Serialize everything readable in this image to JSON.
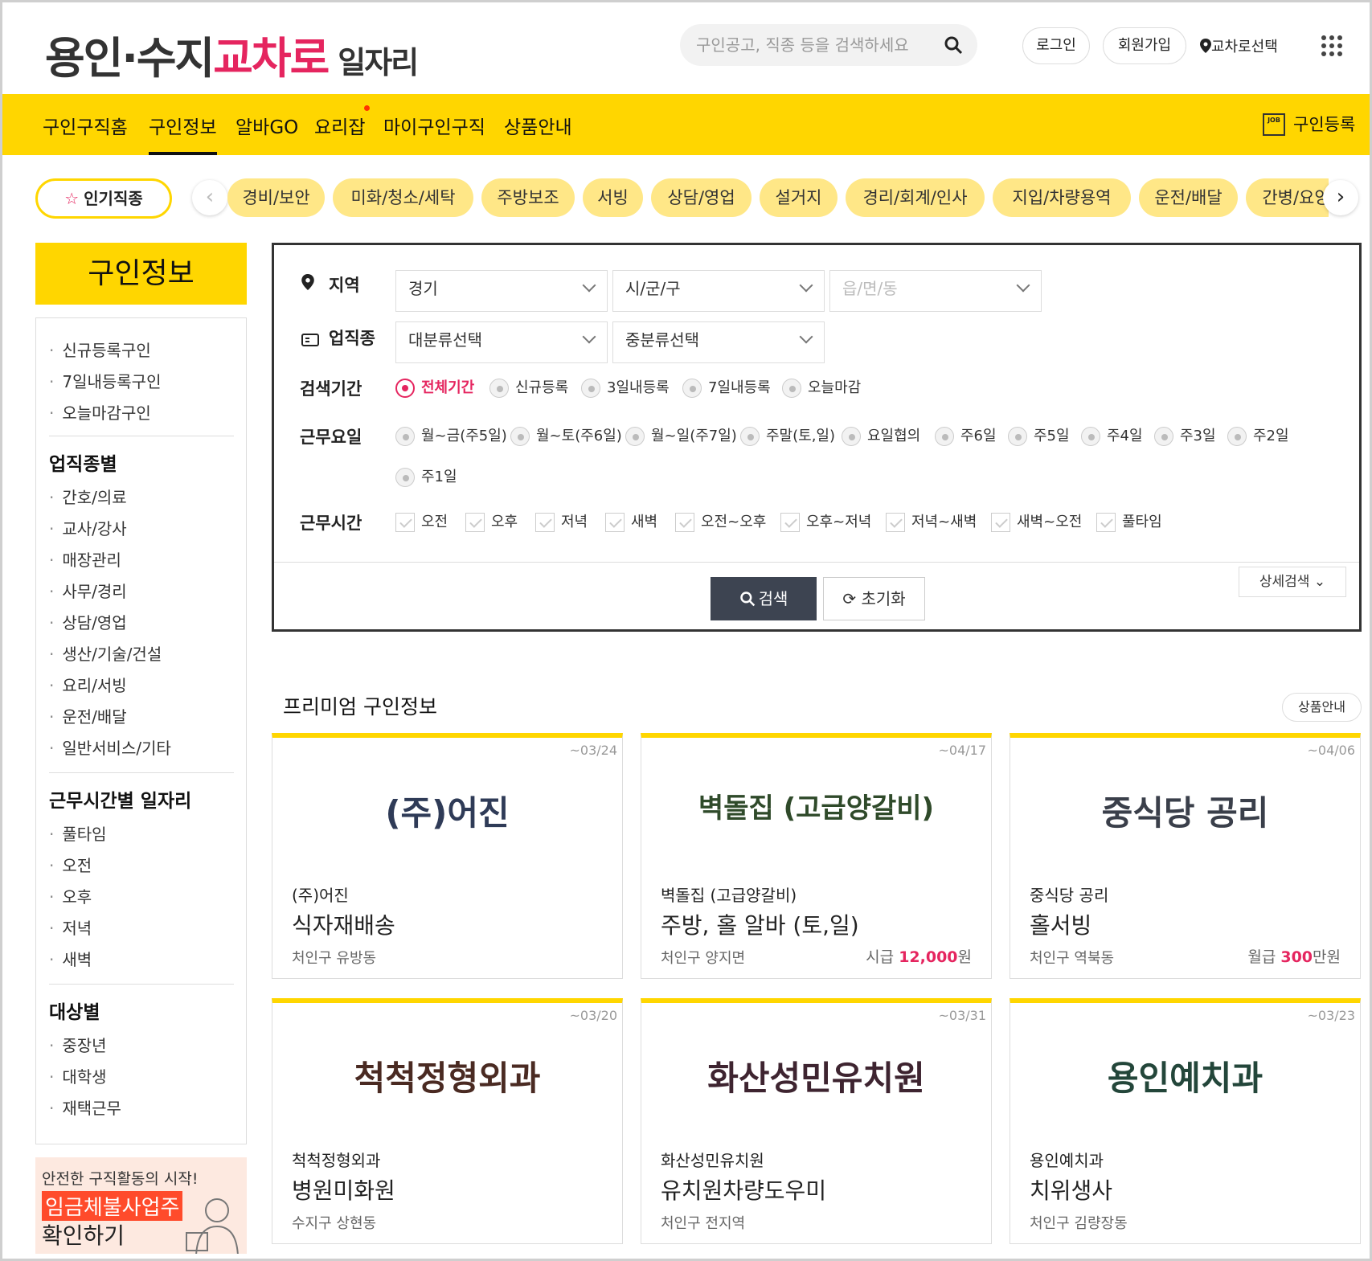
{
  "header": {
    "logo_main": "용인·수지",
    "logo_brand": "교차로",
    "logo_sub": "일자리",
    "search_placeholder": "구인공고, 직종 등을 검색하세요",
    "login": "로그인",
    "signup": "회원가입",
    "area_select": "교차로선택"
  },
  "nav": {
    "items": [
      "구인구직홈",
      "구인정보",
      "알바GO",
      "요리잡",
      "마이구인구직",
      "상품안내"
    ],
    "active": "구인정보",
    "register": "구인등록",
    "job_icon_text": "JOB"
  },
  "chips": {
    "popular": "인기직종",
    "items": [
      "경비/보안",
      "미화/청소/세탁",
      "주방보조",
      "서빙",
      "상담/영업",
      "설거지",
      "경리/회계/인사",
      "지입/차량용역",
      "운전/배달",
      "간병/요양"
    ]
  },
  "sidebar": {
    "title": "구인정보",
    "quick": [
      "신규등록구인",
      "7일내등록구인",
      "오늘마감구인"
    ],
    "sections": [
      {
        "title": "업직종별",
        "items": [
          "간호/의료",
          "교사/강사",
          "매장관리",
          "사무/경리",
          "상담/영업",
          "생산/기술/건설",
          "요리/서빙",
          "운전/배달",
          "일반서비스/기타"
        ]
      },
      {
        "title": "근무시간별 일자리",
        "items": [
          "풀타임",
          "오전",
          "오후",
          "저녁",
          "새벽"
        ]
      },
      {
        "title": "대상별",
        "items": [
          "중장년",
          "대학생",
          "재택근무"
        ]
      }
    ],
    "banner": {
      "line1": "안전한 구직활동의 시작!",
      "line2": "임금체불사업주",
      "line3": "확인하기"
    }
  },
  "search_panel": {
    "region_label": "지역",
    "region": {
      "province": "경기",
      "city": "시/군/구",
      "town": "읍/면/동"
    },
    "job_label": "업직종",
    "job": {
      "major": "대분류선택",
      "minor": "중분류선택"
    },
    "period_label": "검색기간",
    "period_options": [
      "전체기간",
      "신규등록",
      "3일내등록",
      "7일내등록",
      "오늘마감"
    ],
    "period_selected": "전체기간",
    "days_label": "근무요일",
    "days_options": [
      "월~금(주5일)",
      "월~토(주6일)",
      "월~일(주7일)",
      "주말(토,일)",
      "요일협의",
      "주6일",
      "주5일",
      "주4일",
      "주3일",
      "주2일",
      "주1일"
    ],
    "hours_label": "근무시간",
    "hours_options": [
      "오전",
      "오후",
      "저녁",
      "새벽",
      "오전~오후",
      "오후~저녁",
      "저녁~새벽",
      "새벽~오전",
      "풀타임"
    ],
    "detail_search": "상세검색",
    "search_button": "검색",
    "reset_button": "초기화"
  },
  "premium": {
    "title": "프리미엄 구인정보",
    "guide": "상품안내",
    "cards": [
      {
        "date": "~03/24",
        "logo": "(주)어진",
        "logo_color": "#2f3b57",
        "company": "(주)어진",
        "job": "식자재배송",
        "location": "처인구 유방동",
        "pay_label": "",
        "pay_amount": "",
        "pay_unit": ""
      },
      {
        "date": "~04/17",
        "logo": "벽돌집 (고급양갈비)",
        "logo_color": "#2f4a2a",
        "company": "벽돌집 (고급양갈비)",
        "job": "주방, 홀 알바 (토,일)",
        "location": "처인구 양지면",
        "pay_label": "시급",
        "pay_amount": "12,000",
        "pay_unit": "원"
      },
      {
        "date": "~04/06",
        "logo": "중식당 공리",
        "logo_color": "#3a3f4a",
        "company": "중식당 공리",
        "job": "홀서빙",
        "location": "처인구 역북동",
        "pay_label": "월급",
        "pay_amount": "300",
        "pay_unit": "만원"
      },
      {
        "date": "~03/20",
        "logo": "척척정형외과",
        "logo_color": "#4a2a22",
        "company": "척척정형외과",
        "job": "병원미화원",
        "location": "수지구 상현동",
        "pay_label": "",
        "pay_amount": "",
        "pay_unit": ""
      },
      {
        "date": "~03/31",
        "logo": "화산성민유치원",
        "logo_color": "#3e2430",
        "company": "화산성민유치원",
        "job": "유치원차량도우미",
        "location": "처인구 전지역",
        "pay_label": "",
        "pay_amount": "",
        "pay_unit": ""
      },
      {
        "date": "~03/23",
        "logo": "용인예치과",
        "logo_color": "#23463a",
        "company": "용인예치과",
        "job": "치위생사",
        "location": "처인구 김량장동",
        "pay_label": "",
        "pay_amount": "",
        "pay_unit": ""
      }
    ]
  },
  "colors": {
    "brand_yellow": "#ffd600",
    "brand_pink": "#e5255f",
    "chip_yellow": "#ffe787"
  }
}
